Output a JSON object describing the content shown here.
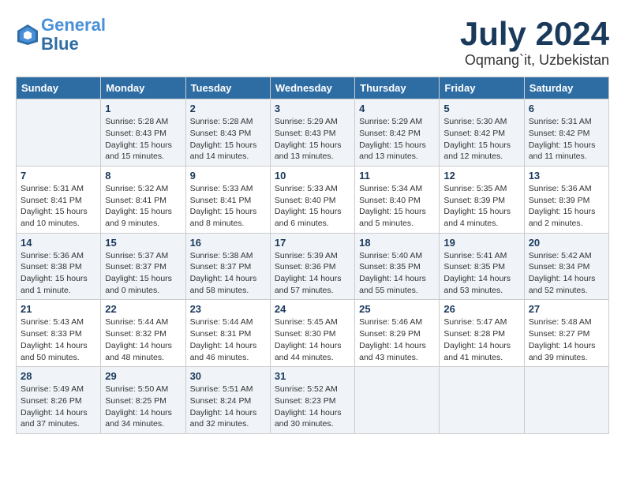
{
  "header": {
    "logo_line1": "General",
    "logo_line2": "Blue",
    "month": "July 2024",
    "location": "Oqmang`it, Uzbekistan"
  },
  "weekdays": [
    "Sunday",
    "Monday",
    "Tuesday",
    "Wednesday",
    "Thursday",
    "Friday",
    "Saturday"
  ],
  "weeks": [
    [
      {
        "day": "",
        "info": ""
      },
      {
        "day": "1",
        "info": "Sunrise: 5:28 AM\nSunset: 8:43 PM\nDaylight: 15 hours\nand 15 minutes."
      },
      {
        "day": "2",
        "info": "Sunrise: 5:28 AM\nSunset: 8:43 PM\nDaylight: 15 hours\nand 14 minutes."
      },
      {
        "day": "3",
        "info": "Sunrise: 5:29 AM\nSunset: 8:43 PM\nDaylight: 15 hours\nand 13 minutes."
      },
      {
        "day": "4",
        "info": "Sunrise: 5:29 AM\nSunset: 8:42 PM\nDaylight: 15 hours\nand 13 minutes."
      },
      {
        "day": "5",
        "info": "Sunrise: 5:30 AM\nSunset: 8:42 PM\nDaylight: 15 hours\nand 12 minutes."
      },
      {
        "day": "6",
        "info": "Sunrise: 5:31 AM\nSunset: 8:42 PM\nDaylight: 15 hours\nand 11 minutes."
      }
    ],
    [
      {
        "day": "7",
        "info": "Sunrise: 5:31 AM\nSunset: 8:41 PM\nDaylight: 15 hours\nand 10 minutes."
      },
      {
        "day": "8",
        "info": "Sunrise: 5:32 AM\nSunset: 8:41 PM\nDaylight: 15 hours\nand 9 minutes."
      },
      {
        "day": "9",
        "info": "Sunrise: 5:33 AM\nSunset: 8:41 PM\nDaylight: 15 hours\nand 8 minutes."
      },
      {
        "day": "10",
        "info": "Sunrise: 5:33 AM\nSunset: 8:40 PM\nDaylight: 15 hours\nand 6 minutes."
      },
      {
        "day": "11",
        "info": "Sunrise: 5:34 AM\nSunset: 8:40 PM\nDaylight: 15 hours\nand 5 minutes."
      },
      {
        "day": "12",
        "info": "Sunrise: 5:35 AM\nSunset: 8:39 PM\nDaylight: 15 hours\nand 4 minutes."
      },
      {
        "day": "13",
        "info": "Sunrise: 5:36 AM\nSunset: 8:39 PM\nDaylight: 15 hours\nand 2 minutes."
      }
    ],
    [
      {
        "day": "14",
        "info": "Sunrise: 5:36 AM\nSunset: 8:38 PM\nDaylight: 15 hours\nand 1 minute."
      },
      {
        "day": "15",
        "info": "Sunrise: 5:37 AM\nSunset: 8:37 PM\nDaylight: 15 hours\nand 0 minutes."
      },
      {
        "day": "16",
        "info": "Sunrise: 5:38 AM\nSunset: 8:37 PM\nDaylight: 14 hours\nand 58 minutes."
      },
      {
        "day": "17",
        "info": "Sunrise: 5:39 AM\nSunset: 8:36 PM\nDaylight: 14 hours\nand 57 minutes."
      },
      {
        "day": "18",
        "info": "Sunrise: 5:40 AM\nSunset: 8:35 PM\nDaylight: 14 hours\nand 55 minutes."
      },
      {
        "day": "19",
        "info": "Sunrise: 5:41 AM\nSunset: 8:35 PM\nDaylight: 14 hours\nand 53 minutes."
      },
      {
        "day": "20",
        "info": "Sunrise: 5:42 AM\nSunset: 8:34 PM\nDaylight: 14 hours\nand 52 minutes."
      }
    ],
    [
      {
        "day": "21",
        "info": "Sunrise: 5:43 AM\nSunset: 8:33 PM\nDaylight: 14 hours\nand 50 minutes."
      },
      {
        "day": "22",
        "info": "Sunrise: 5:44 AM\nSunset: 8:32 PM\nDaylight: 14 hours\nand 48 minutes."
      },
      {
        "day": "23",
        "info": "Sunrise: 5:44 AM\nSunset: 8:31 PM\nDaylight: 14 hours\nand 46 minutes."
      },
      {
        "day": "24",
        "info": "Sunrise: 5:45 AM\nSunset: 8:30 PM\nDaylight: 14 hours\nand 44 minutes."
      },
      {
        "day": "25",
        "info": "Sunrise: 5:46 AM\nSunset: 8:29 PM\nDaylight: 14 hours\nand 43 minutes."
      },
      {
        "day": "26",
        "info": "Sunrise: 5:47 AM\nSunset: 8:28 PM\nDaylight: 14 hours\nand 41 minutes."
      },
      {
        "day": "27",
        "info": "Sunrise: 5:48 AM\nSunset: 8:27 PM\nDaylight: 14 hours\nand 39 minutes."
      }
    ],
    [
      {
        "day": "28",
        "info": "Sunrise: 5:49 AM\nSunset: 8:26 PM\nDaylight: 14 hours\nand 37 minutes."
      },
      {
        "day": "29",
        "info": "Sunrise: 5:50 AM\nSunset: 8:25 PM\nDaylight: 14 hours\nand 34 minutes."
      },
      {
        "day": "30",
        "info": "Sunrise: 5:51 AM\nSunset: 8:24 PM\nDaylight: 14 hours\nand 32 minutes."
      },
      {
        "day": "31",
        "info": "Sunrise: 5:52 AM\nSunset: 8:23 PM\nDaylight: 14 hours\nand 30 minutes."
      },
      {
        "day": "",
        "info": ""
      },
      {
        "day": "",
        "info": ""
      },
      {
        "day": "",
        "info": ""
      }
    ]
  ]
}
